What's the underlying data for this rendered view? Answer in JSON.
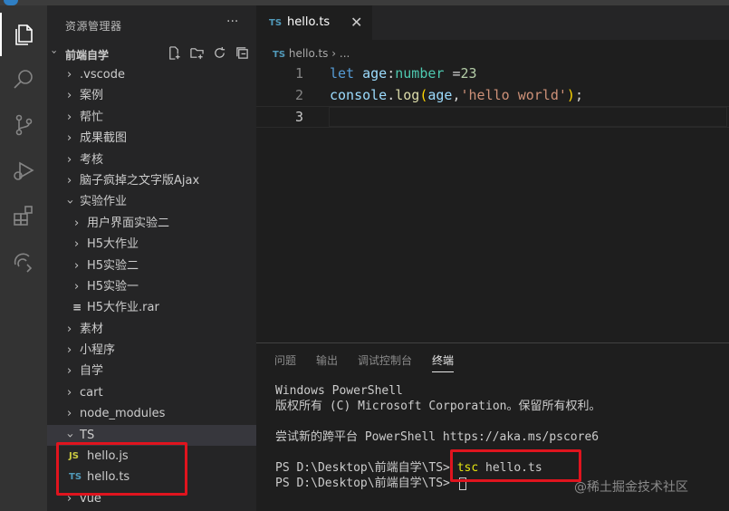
{
  "colors": {
    "highlight_box": "#e0141e",
    "ts_icon": "#519aba",
    "js_icon": "#cbcb41"
  },
  "activity_bar": {
    "icons": [
      "files-icon",
      "search-icon",
      "source-control-icon",
      "run-debug-icon",
      "extensions-icon",
      "remote-icon"
    ]
  },
  "explorer": {
    "title": "资源管理器",
    "more": "···",
    "folder_name": "前端自学",
    "tree": [
      {
        "label": ".vscode",
        "type": "folder",
        "depth": 1,
        "expanded": false
      },
      {
        "label": "案例",
        "type": "folder",
        "depth": 1,
        "expanded": false
      },
      {
        "label": "帮忙",
        "type": "folder",
        "depth": 1,
        "expanded": false
      },
      {
        "label": "成果截图",
        "type": "folder",
        "depth": 1,
        "expanded": false
      },
      {
        "label": "考核",
        "type": "folder",
        "depth": 1,
        "expanded": false
      },
      {
        "label": "脑子疯掉之文字版Ajax",
        "type": "folder",
        "depth": 1,
        "expanded": false
      },
      {
        "label": "实验作业",
        "type": "folder",
        "depth": 1,
        "expanded": true
      },
      {
        "label": "用户界面实验二",
        "type": "folder",
        "depth": 2,
        "expanded": false
      },
      {
        "label": "H5大作业",
        "type": "folder",
        "depth": 2,
        "expanded": false
      },
      {
        "label": "H5实验二",
        "type": "folder",
        "depth": 2,
        "expanded": false
      },
      {
        "label": "H5实验一",
        "type": "folder",
        "depth": 2,
        "expanded": false
      },
      {
        "label": "H5大作业.rar",
        "type": "rar",
        "depth": 2
      },
      {
        "label": "素材",
        "type": "folder",
        "depth": 1,
        "expanded": false
      },
      {
        "label": "小程序",
        "type": "folder",
        "depth": 1,
        "expanded": false
      },
      {
        "label": "自学",
        "type": "folder",
        "depth": 1,
        "expanded": false
      },
      {
        "label": "cart",
        "type": "folder",
        "depth": 1,
        "expanded": false
      },
      {
        "label": "node_modules",
        "type": "folder",
        "depth": 1,
        "expanded": false
      },
      {
        "label": "TS",
        "type": "folder",
        "depth": 1,
        "expanded": true,
        "selected": true
      },
      {
        "label": "hello.js",
        "type": "js",
        "depth": 2,
        "icon_text": "JS"
      },
      {
        "label": "hello.ts",
        "type": "ts",
        "depth": 2,
        "icon_text": "TS"
      },
      {
        "label": "vue",
        "type": "folder",
        "depth": 1,
        "expanded": false
      }
    ]
  },
  "editor": {
    "tab": {
      "icon_text": "TS",
      "label": "hello.ts",
      "close": "✕"
    },
    "breadcrumb": {
      "icon_text": "TS",
      "file": "hello.ts",
      "sep": "›",
      "more": "..."
    },
    "line_numbers": [
      "1",
      "2",
      "3"
    ],
    "code": {
      "l1_kw": "let",
      "l1_var": "age",
      "l1_colon": ":",
      "l1_type": "number",
      "l1_eq": " =",
      "l1_num": "23",
      "l2_obj": "console",
      "l2_dot": ".",
      "l2_fn": "log",
      "l2_open": "(",
      "l2_arg": "age",
      "l2_comma": ",",
      "l2_str": "'hello world'",
      "l2_close": ")",
      "l2_semi": ";"
    }
  },
  "panel": {
    "tabs": [
      "问题",
      "输出",
      "调试控制台",
      "终端"
    ],
    "active_tab": "终端",
    "terminal": {
      "line1": "Windows PowerShell",
      "line2": "版权所有 (C) Microsoft Corporation。保留所有权利。",
      "line3": "尝试新的跨平台 PowerShell https://aka.ms/pscore6",
      "prompt": "PS D:\\Desktop\\前端自学\\TS>",
      "cmd": "tsc",
      "cmd_arg": "hello.ts"
    }
  },
  "watermark": "@稀土掘金技术社区"
}
